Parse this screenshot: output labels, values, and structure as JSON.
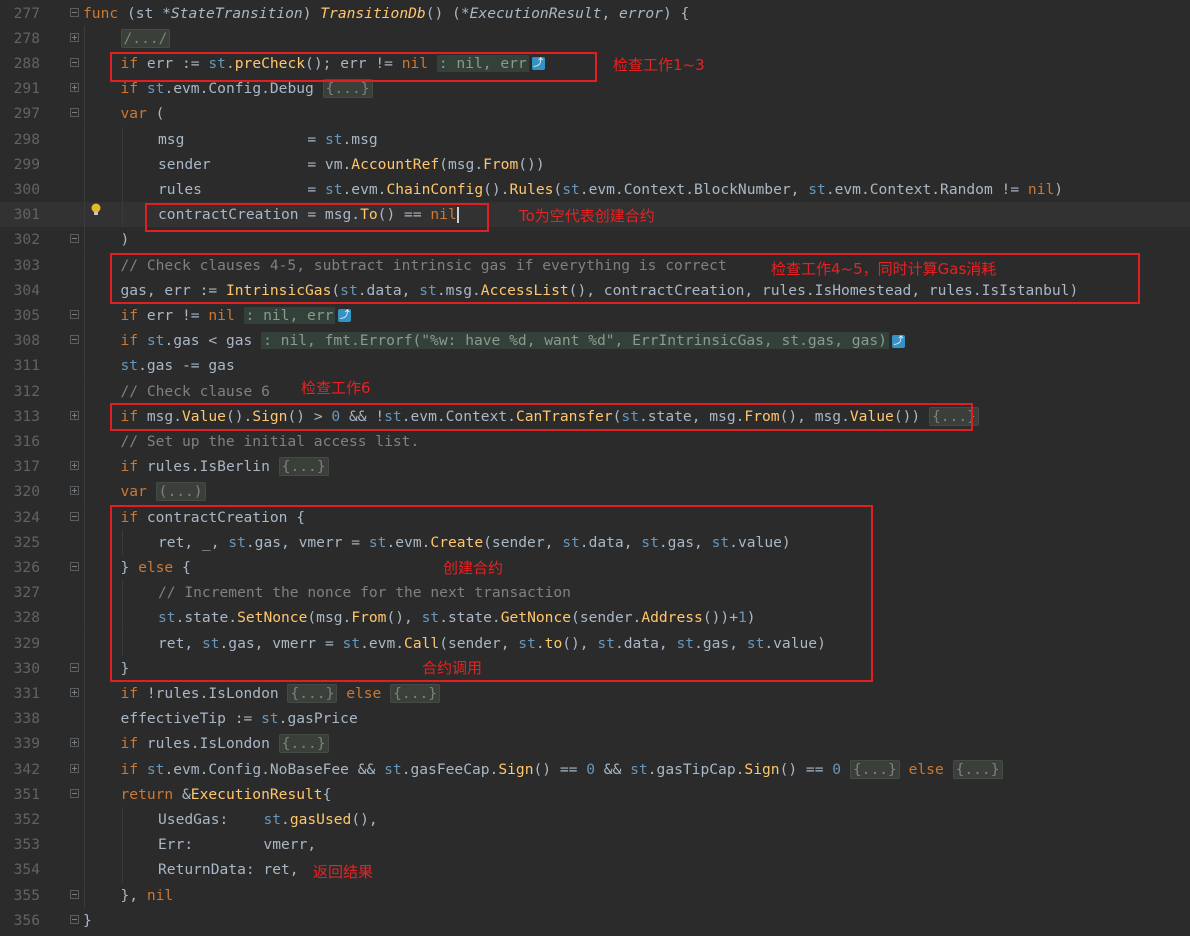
{
  "editor": {
    "lines": [
      {
        "n": "277",
        "segments": [
          [
            "k",
            "func"
          ],
          [
            "p",
            " ("
          ],
          [
            "p",
            "st *"
          ],
          [
            "ty",
            "StateTransition"
          ],
          [
            "p",
            ") "
          ],
          [
            "fn",
            "TransitionDb"
          ],
          [
            "p",
            "() (*"
          ],
          [
            "ty",
            "ExecutionResult"
          ],
          [
            "p",
            ", "
          ],
          [
            "ty",
            "error"
          ],
          [
            "p",
            ") {"
          ]
        ]
      },
      {
        "n": "278",
        "indent": 1,
        "segments": [
          [
            "fold",
            "/.../"
          ]
        ]
      },
      {
        "n": "288",
        "indent": 1,
        "segments": [
          [
            "k",
            "if"
          ],
          [
            "p",
            " err := "
          ],
          [
            "v",
            "st"
          ],
          [
            "p",
            "."
          ],
          [
            "call",
            "preCheck"
          ],
          [
            "p",
            "(); err != "
          ],
          [
            "k",
            "nil"
          ],
          [
            "p",
            " "
          ],
          [
            "hint",
            ": nil, err"
          ],
          [
            "jump",
            "J"
          ]
        ]
      },
      {
        "n": "291",
        "indent": 1,
        "segments": [
          [
            "k",
            "if"
          ],
          [
            "p",
            " "
          ],
          [
            "v",
            "st"
          ],
          [
            "p",
            ".evm.Config.Debug "
          ],
          [
            "fold",
            "{...}"
          ]
        ]
      },
      {
        "n": "297",
        "indent": 1,
        "segments": [
          [
            "k",
            "var"
          ],
          [
            "p",
            " ("
          ]
        ]
      },
      {
        "n": "298",
        "indent": 2,
        "segments": [
          [
            "p",
            "msg              = "
          ],
          [
            "v",
            "st"
          ],
          [
            "p",
            ".msg"
          ]
        ]
      },
      {
        "n": "299",
        "indent": 2,
        "segments": [
          [
            "p",
            "sender           = vm."
          ],
          [
            "call",
            "AccountRef"
          ],
          [
            "p",
            "(msg."
          ],
          [
            "call",
            "From"
          ],
          [
            "p",
            "())"
          ]
        ]
      },
      {
        "n": "300",
        "indent": 2,
        "segments": [
          [
            "p",
            "rules            = "
          ],
          [
            "v",
            "st"
          ],
          [
            "p",
            ".evm."
          ],
          [
            "call",
            "ChainConfig"
          ],
          [
            "p",
            "()."
          ],
          [
            "call",
            "Rules"
          ],
          [
            "p",
            "("
          ],
          [
            "v",
            "st"
          ],
          [
            "p",
            ".evm.Context.BlockNumber, "
          ],
          [
            "v",
            "st"
          ],
          [
            "p",
            ".evm.Context.Random != "
          ],
          [
            "k",
            "nil"
          ],
          [
            "p",
            ")"
          ]
        ]
      },
      {
        "n": "301",
        "indent": 2,
        "current": true,
        "segments": [
          [
            "p",
            "contractCreation = msg."
          ],
          [
            "call",
            "To"
          ],
          [
            "p",
            "() == "
          ],
          [
            "k",
            "nil"
          ],
          [
            "caret",
            ""
          ]
        ]
      },
      {
        "n": "302",
        "indent": 1,
        "segments": [
          [
            "p",
            ")"
          ]
        ]
      },
      {
        "n": "303",
        "indent": 1,
        "segments": [
          [
            "cm",
            "// Check clauses 4-5, subtract intrinsic gas if everything is correct"
          ]
        ]
      },
      {
        "n": "304",
        "indent": 1,
        "segments": [
          [
            "p",
            "gas, err := "
          ],
          [
            "call",
            "IntrinsicGas"
          ],
          [
            "p",
            "("
          ],
          [
            "v",
            "st"
          ],
          [
            "p",
            ".data, "
          ],
          [
            "v",
            "st"
          ],
          [
            "p",
            ".msg."
          ],
          [
            "call",
            "AccessList"
          ],
          [
            "p",
            "(), contractCreation, rules.IsHomestead, rules.IsIstanbul)"
          ]
        ]
      },
      {
        "n": "305",
        "indent": 1,
        "segments": [
          [
            "k",
            "if"
          ],
          [
            "p",
            " err != "
          ],
          [
            "k",
            "nil"
          ],
          [
            "p",
            " "
          ],
          [
            "hint",
            ": nil, err"
          ],
          [
            "jump",
            "J"
          ]
        ]
      },
      {
        "n": "308",
        "indent": 1,
        "segments": [
          [
            "k",
            "if"
          ],
          [
            "p",
            " "
          ],
          [
            "v",
            "st"
          ],
          [
            "p",
            ".gas < gas "
          ],
          [
            "hint",
            ": nil, fmt.Errorf(\"%w: have %d, want %d\", ErrIntrinsicGas, st.gas, gas)"
          ],
          [
            "jump",
            "J"
          ]
        ]
      },
      {
        "n": "311",
        "indent": 1,
        "segments": [
          [
            "v",
            "st"
          ],
          [
            "p",
            ".gas -= gas"
          ]
        ]
      },
      {
        "n": "312",
        "indent": 1,
        "segments": [
          [
            "cm",
            "// Check clause 6"
          ]
        ]
      },
      {
        "n": "313",
        "indent": 1,
        "segments": [
          [
            "k",
            "if"
          ],
          [
            "p",
            " msg."
          ],
          [
            "call",
            "Value"
          ],
          [
            "p",
            "()."
          ],
          [
            "call",
            "Sign"
          ],
          [
            "p",
            "() > "
          ],
          [
            "num",
            "0"
          ],
          [
            "p",
            " && !"
          ],
          [
            "v",
            "st"
          ],
          [
            "p",
            ".evm.Context."
          ],
          [
            "call",
            "CanTransfer"
          ],
          [
            "p",
            "("
          ],
          [
            "v",
            "st"
          ],
          [
            "p",
            ".state, msg."
          ],
          [
            "call",
            "From"
          ],
          [
            "p",
            "(), msg."
          ],
          [
            "call",
            "Value"
          ],
          [
            "p",
            "()) "
          ],
          [
            "fold",
            "{...}"
          ]
        ]
      },
      {
        "n": "316",
        "indent": 1,
        "segments": [
          [
            "cm",
            "// Set up the initial access list."
          ]
        ]
      },
      {
        "n": "317",
        "indent": 1,
        "segments": [
          [
            "k",
            "if"
          ],
          [
            "p",
            " rules.IsBerlin "
          ],
          [
            "fold",
            "{...}"
          ]
        ]
      },
      {
        "n": "320",
        "indent": 1,
        "segments": [
          [
            "k",
            "var"
          ],
          [
            "p",
            " "
          ],
          [
            "fold",
            "(...)"
          ]
        ]
      },
      {
        "n": "324",
        "indent": 1,
        "segments": [
          [
            "k",
            "if"
          ],
          [
            "p",
            " contractCreation {"
          ]
        ]
      },
      {
        "n": "325",
        "indent": 2,
        "segments": [
          [
            "p",
            "ret, _, "
          ],
          [
            "v",
            "st"
          ],
          [
            "p",
            ".gas, vmerr = "
          ],
          [
            "v",
            "st"
          ],
          [
            "p",
            ".evm."
          ],
          [
            "call",
            "Create"
          ],
          [
            "p",
            "(sender, "
          ],
          [
            "v",
            "st"
          ],
          [
            "p",
            ".data, "
          ],
          [
            "v",
            "st"
          ],
          [
            "p",
            ".gas, "
          ],
          [
            "v",
            "st"
          ],
          [
            "p",
            ".value)"
          ]
        ]
      },
      {
        "n": "326",
        "indent": 1,
        "segments": [
          [
            "p",
            "} "
          ],
          [
            "k",
            "else"
          ],
          [
            "p",
            " {"
          ]
        ]
      },
      {
        "n": "327",
        "indent": 2,
        "segments": [
          [
            "cm",
            "// Increment the nonce for the next transaction"
          ]
        ]
      },
      {
        "n": "328",
        "indent": 2,
        "segments": [
          [
            "v",
            "st"
          ],
          [
            "p",
            ".state."
          ],
          [
            "call",
            "SetNonce"
          ],
          [
            "p",
            "(msg."
          ],
          [
            "call",
            "From"
          ],
          [
            "p",
            "(), "
          ],
          [
            "v",
            "st"
          ],
          [
            "p",
            ".state."
          ],
          [
            "call",
            "GetNonce"
          ],
          [
            "p",
            "(sender."
          ],
          [
            "call",
            "Address"
          ],
          [
            "p",
            "())+"
          ],
          [
            "num",
            "1"
          ],
          [
            "p",
            ")"
          ]
        ]
      },
      {
        "n": "329",
        "indent": 2,
        "segments": [
          [
            "p",
            "ret, "
          ],
          [
            "v",
            "st"
          ],
          [
            "p",
            ".gas, vmerr = "
          ],
          [
            "v",
            "st"
          ],
          [
            "p",
            ".evm."
          ],
          [
            "call",
            "Call"
          ],
          [
            "p",
            "(sender, "
          ],
          [
            "v",
            "st"
          ],
          [
            "p",
            "."
          ],
          [
            "call",
            "to"
          ],
          [
            "p",
            "(), "
          ],
          [
            "v",
            "st"
          ],
          [
            "p",
            ".data, "
          ],
          [
            "v",
            "st"
          ],
          [
            "p",
            ".gas, "
          ],
          [
            "v",
            "st"
          ],
          [
            "p",
            ".value)"
          ]
        ]
      },
      {
        "n": "330",
        "indent": 1,
        "segments": [
          [
            "p",
            "}"
          ]
        ]
      },
      {
        "n": "331",
        "indent": 1,
        "segments": [
          [
            "k",
            "if"
          ],
          [
            "p",
            " !rules.IsLondon "
          ],
          [
            "fold",
            "{...}"
          ],
          [
            "p",
            " "
          ],
          [
            "k",
            "else"
          ],
          [
            "p",
            " "
          ],
          [
            "fold",
            "{...}"
          ]
        ]
      },
      {
        "n": "338",
        "indent": 1,
        "segments": [
          [
            "p",
            "effectiveTip := "
          ],
          [
            "v",
            "st"
          ],
          [
            "p",
            ".gasPrice"
          ]
        ]
      },
      {
        "n": "339",
        "indent": 1,
        "segments": [
          [
            "k",
            "if"
          ],
          [
            "p",
            " rules.IsLondon "
          ],
          [
            "fold",
            "{...}"
          ]
        ]
      },
      {
        "n": "342",
        "indent": 1,
        "segments": [
          [
            "k",
            "if"
          ],
          [
            "p",
            " "
          ],
          [
            "v",
            "st"
          ],
          [
            "p",
            ".evm.Config.NoBaseFee && "
          ],
          [
            "v",
            "st"
          ],
          [
            "p",
            ".gasFeeCap."
          ],
          [
            "call",
            "Sign"
          ],
          [
            "p",
            "() == "
          ],
          [
            "num",
            "0"
          ],
          [
            "p",
            " && "
          ],
          [
            "v",
            "st"
          ],
          [
            "p",
            ".gasTipCap."
          ],
          [
            "call",
            "Sign"
          ],
          [
            "p",
            "() == "
          ],
          [
            "num",
            "0"
          ],
          [
            "p",
            " "
          ],
          [
            "fold",
            "{...}"
          ],
          [
            "p",
            " "
          ],
          [
            "k",
            "else"
          ],
          [
            "p",
            " "
          ],
          [
            "fold",
            "{...}"
          ]
        ]
      },
      {
        "n": "351",
        "indent": 1,
        "segments": [
          [
            "k",
            "return"
          ],
          [
            "p",
            " &"
          ],
          [
            "call",
            "ExecutionResult"
          ],
          [
            "p",
            "{"
          ]
        ]
      },
      {
        "n": "352",
        "indent": 2,
        "segments": [
          [
            "p",
            "UsedGas:    "
          ],
          [
            "v",
            "st"
          ],
          [
            "p",
            "."
          ],
          [
            "call",
            "gasUsed"
          ],
          [
            "p",
            "(),"
          ]
        ]
      },
      {
        "n": "353",
        "indent": 2,
        "segments": [
          [
            "p",
            "Err:        vmerr,"
          ]
        ]
      },
      {
        "n": "354",
        "indent": 2,
        "segments": [
          [
            "p",
            "ReturnData: ret,"
          ]
        ]
      },
      {
        "n": "355",
        "indent": 1,
        "segments": [
          [
            "p",
            "}, "
          ],
          [
            "k",
            "nil"
          ]
        ]
      },
      {
        "n": "356",
        "indent": 0,
        "segments": [
          [
            "p",
            "}"
          ]
        ]
      }
    ]
  },
  "annotations": {
    "check_1_3": "检查工作1~3",
    "to_nil": "To为空代表创建合约",
    "check_4_5": "检查工作4~5，同时计算Gas消耗",
    "check_6": "检查工作6",
    "create": "创建合约",
    "call": "合约调用",
    "return": "返回结果"
  },
  "colors": {
    "background": "#2b2b2b",
    "keyword": "#cc7832",
    "function": "#ffc66d",
    "number": "#6897bb",
    "comment": "#808080",
    "annotation": "#e02020"
  }
}
